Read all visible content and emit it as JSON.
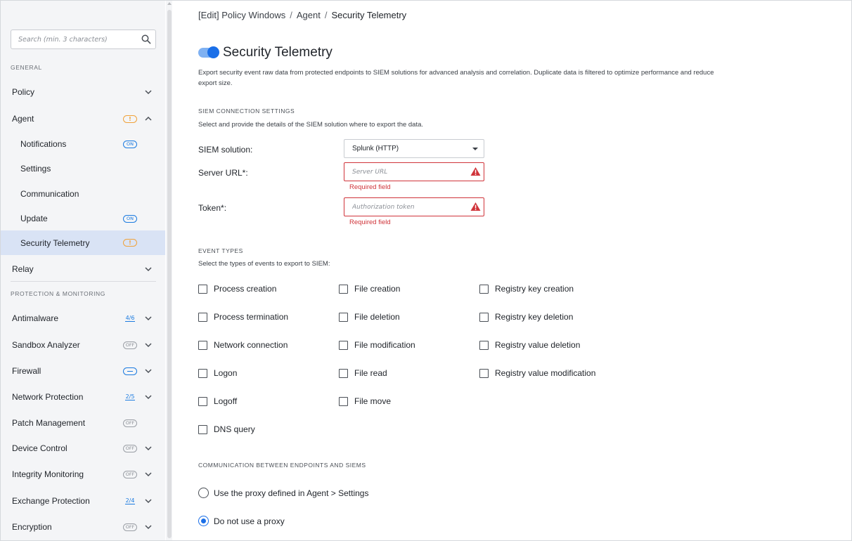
{
  "sidebar": {
    "search_placeholder": "Search (min. 3 characters)",
    "section_general": "GENERAL",
    "section_protection": "PROTECTION & MONITORING",
    "items": {
      "policy": "Policy",
      "agent": "Agent",
      "notifications": "Notifications",
      "settings": "Settings",
      "communication": "Communication",
      "update": "Update",
      "security_telemetry": "Security Telemetry",
      "relay": "Relay",
      "antimalware": "Antimalware",
      "sandbox_analyzer": "Sandbox Analyzer",
      "firewall": "Firewall",
      "network_protection": "Network Protection",
      "patch_management": "Patch Management",
      "device_control": "Device Control",
      "integrity_monitoring": "Integrity Monitoring",
      "exchange_protection": "Exchange Protection",
      "encryption": "Encryption"
    },
    "badges": {
      "warn": "!",
      "on": "ON",
      "off": "OFF",
      "antimalware": "4/6",
      "network_protection": "2/5",
      "exchange_protection": "2/4"
    },
    "active_item": "Security Telemetry"
  },
  "breadcrumb": {
    "part1": "[Edit] Policy Windows",
    "part2": "Agent",
    "current": "Security Telemetry",
    "separator": "/"
  },
  "page": {
    "title": "Security Telemetry",
    "enabled": true,
    "description": "Export security event raw data from protected endpoints to SIEM solutions for advanced analysis and correlation. Duplicate data is filtered to optimize performance and reduce export size."
  },
  "siem": {
    "heading": "SIEM CONNECTION SETTINGS",
    "subheading": "Select and provide the details of the SIEM solution where to export the data.",
    "solution_label": "SIEM solution:",
    "solution_value": "Splunk (HTTP)",
    "server_url_label": "Server URL*:",
    "server_url_placeholder": "Server URL",
    "server_url_value": "",
    "token_label": "Token*:",
    "token_placeholder": "Authorization token",
    "token_value": "",
    "error_text": "Required field"
  },
  "event_types": {
    "heading": "EVENT TYPES",
    "subheading": "Select the types of events to export to SIEM:",
    "process_creation": "Process creation",
    "process_termination": "Process termination",
    "network_connection": "Network connection",
    "logon": "Logon",
    "logoff": "Logoff",
    "dns_query": "DNS query",
    "file_creation": "File creation",
    "file_deletion": "File deletion",
    "file_modification": "File modification",
    "file_read": "File read",
    "file_move": "File move",
    "registry_key_creation": "Registry key creation",
    "registry_key_deletion": "Registry key deletion",
    "registry_value_deletion": "Registry value deletion",
    "registry_value_modification": "Registry value modification"
  },
  "communication": {
    "heading": "COMMUNICATION BETWEEN ENDPOINTS AND SIEMS",
    "option_proxy": "Use the proxy defined in Agent > Settings",
    "option_no_proxy": "Do not use a proxy",
    "selected": "Do not use a proxy"
  },
  "colors": {
    "accent": "#1a6fe8",
    "error": "#d0343a",
    "warning": "#f0a23a",
    "sidebar_bg": "#f4f5f7",
    "active_bg": "#d9e3f5"
  }
}
